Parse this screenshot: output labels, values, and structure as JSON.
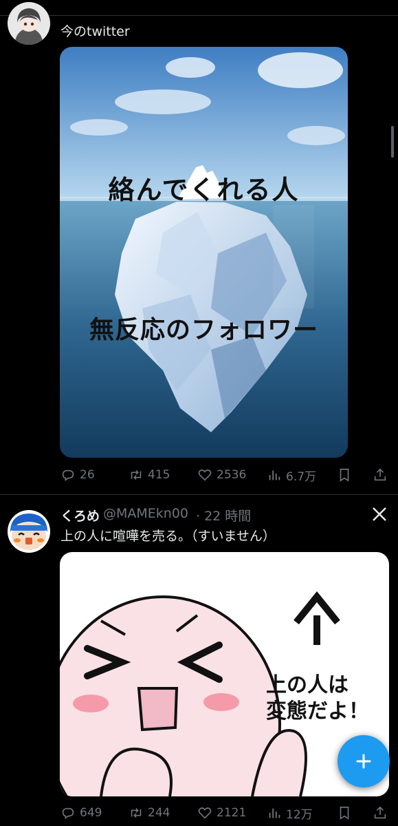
{
  "tweet1": {
    "text": "今のtwitter",
    "image": {
      "label_top": "絡んでくれる人",
      "label_bottom": "無反応のフォロワー"
    },
    "actions": {
      "replies": "26",
      "retweets": "415",
      "likes": "2536",
      "views": "6.7万"
    }
  },
  "tweet2": {
    "name": "くろめ",
    "handle": "@MAMEkn00",
    "time": "· 22 時間",
    "text": "上の人に喧嘩を売る。（すいません）",
    "image": {
      "caption_line1": "上の人は",
      "caption_line2": "変態だよ！"
    },
    "actions": {
      "replies": "649",
      "retweets": "244",
      "likes": "2121",
      "views": "12万"
    }
  },
  "icons": [
    "reply-icon",
    "retweet-icon",
    "like-icon",
    "views-icon",
    "bookmark-icon",
    "share-icon",
    "x-logo-icon",
    "compose-plus-icon"
  ],
  "colors": {
    "background": "#000000",
    "accent": "#1d9bf0",
    "muted": "#71767b"
  }
}
